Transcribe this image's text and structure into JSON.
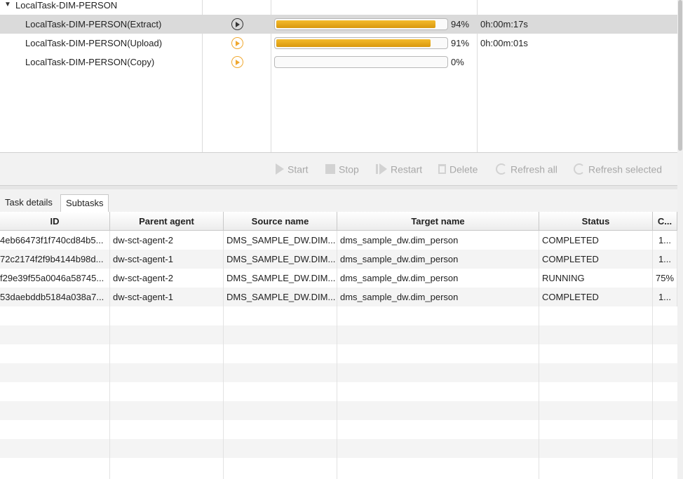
{
  "task_tree": {
    "parent": {
      "label": "LocalTask-DIM-PERSON",
      "expanded": true
    },
    "rows": [
      {
        "name": "LocalTask-DIM-PERSON(Extract)",
        "icon": "play-circle-icon",
        "progress": 94,
        "percent": "94%",
        "duration": "0h:00m:17s",
        "selected": true
      },
      {
        "name": "LocalTask-DIM-PERSON(Upload)",
        "icon": "play-circle-icon",
        "progress": 91,
        "percent": "91%",
        "duration": "0h:00m:01s",
        "selected": false
      },
      {
        "name": "LocalTask-DIM-PERSON(Copy)",
        "icon": "play-circle-icon",
        "progress": 0,
        "percent": "0%",
        "duration": "",
        "selected": false
      }
    ]
  },
  "toolbar": {
    "start": "Start",
    "stop": "Stop",
    "restart": "Restart",
    "delete": "Delete",
    "refresh_all": "Refresh all",
    "refresh_selected": "Refresh selected"
  },
  "tabs": [
    {
      "label": "Task details",
      "active": false
    },
    {
      "label": "Subtasks",
      "active": true
    }
  ],
  "subtasks": {
    "columns": [
      "ID",
      "Parent agent",
      "Source name",
      "Target name",
      "Status",
      "C..."
    ],
    "rows": [
      [
        "4eb66473f1f740cd84b5...",
        "dw-sct-agent-2",
        "DMS_SAMPLE_DW.DIM...",
        "dms_sample_dw.dim_person",
        "COMPLETED",
        "1..."
      ],
      [
        "72c2174f2f9b4144b98d...",
        "dw-sct-agent-1",
        "DMS_SAMPLE_DW.DIM...",
        "dms_sample_dw.dim_person",
        "COMPLETED",
        "1..."
      ],
      [
        "f29e39f55a0046a58745...",
        "dw-sct-agent-2",
        "DMS_SAMPLE_DW.DIM...",
        "dms_sample_dw.dim_person",
        "RUNNING",
        "75%"
      ],
      [
        "53daebddb5184a038a7...",
        "dw-sct-agent-1",
        "DMS_SAMPLE_DW.DIM...",
        "dms_sample_dw.dim_person",
        "COMPLETED",
        "1..."
      ]
    ]
  },
  "colors": {
    "progress_fill": "#e8a81c",
    "play_active": "#f0a830",
    "play_selected": "#333333",
    "selection": "#dadada"
  }
}
